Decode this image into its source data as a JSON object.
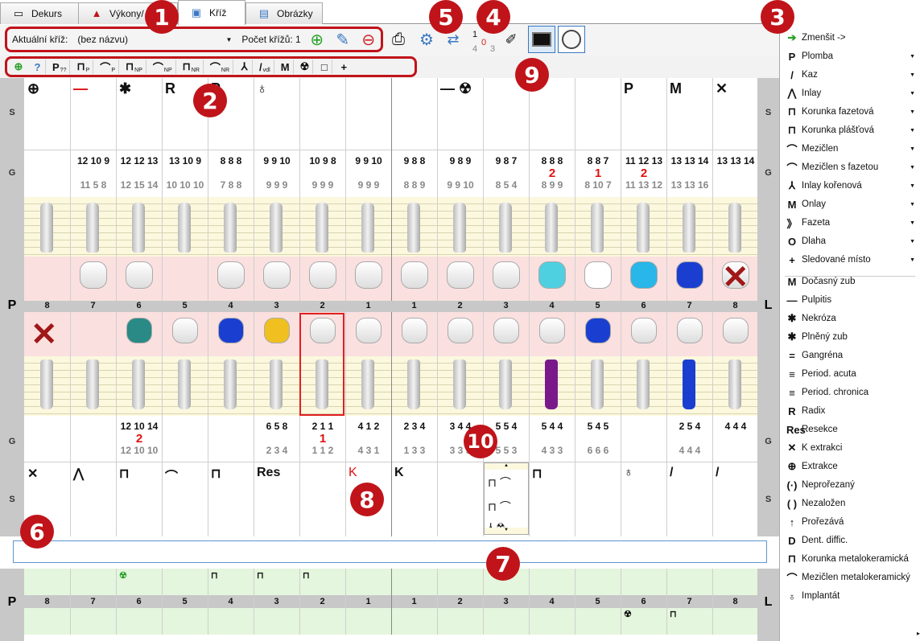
{
  "tabs": [
    {
      "label": "Dekurs",
      "icon": "document-icon"
    },
    {
      "label": "Výkony/",
      "icon": "procedures-icon"
    },
    {
      "label": "Kříž",
      "icon": "tooth-icon",
      "active": true
    },
    {
      "label": "Obrázky",
      "icon": "images-icon"
    }
  ],
  "toolbar": {
    "current_label": "Aktuální kříž:",
    "current_value": "(bez názvu)",
    "count_label": "Počet křížů: 1",
    "counter_top": "1",
    "counter_mid": "0",
    "counter_left": "4",
    "counter_right": "3"
  },
  "tools": [
    "P",
    "⊓",
    "⌒",
    "⊓",
    "⌒",
    "⊓",
    "⌒",
    "⅄",
    "/",
    "M",
    "☢",
    "□",
    "+"
  ],
  "tool_subs": [
    "??",
    "P",
    "P",
    "NP",
    "NP",
    "NR",
    "NR",
    "",
    "vdl",
    "",
    "",
    "",
    ""
  ],
  "side_labels": {
    "s": "S",
    "g": "G",
    "p": "P",
    "l": "L"
  },
  "upper_numbers": [
    "8",
    "7",
    "6",
    "5",
    "4",
    "3",
    "2",
    "1",
    "1",
    "2",
    "3",
    "4",
    "5",
    "6",
    "7",
    "8"
  ],
  "lower_numbers": [
    "8",
    "7",
    "6",
    "5",
    "4",
    "3",
    "2",
    "1",
    "1",
    "2",
    "3",
    "4",
    "5",
    "6",
    "7",
    "8"
  ],
  "upper_symbols": [
    "⊕",
    "—",
    "✱",
    "R",
    "P",
    "♁",
    "",
    "",
    "",
    "— ☢",
    "",
    "",
    "",
    "P",
    "M",
    "✕"
  ],
  "upper_g_top": [
    "",
    "12 10 9",
    "12 12 13",
    "13 10 9",
    "8 8 8",
    "9 9 10",
    "10 9 8",
    "9 9 10",
    "9 8 8",
    "9 8 9",
    "9 8 7",
    "8 8 8",
    "8 8 7",
    "11 12 13",
    "13 13 14",
    "13 13 14"
  ],
  "upper_g_bot": [
    "",
    "11 5 8",
    "12 15 14",
    "10 10 10",
    "7 8 8",
    "9 9 9",
    "9 9 9",
    "9 9 9",
    "8 8 9",
    "9 9 10",
    "8 5 4",
    "8 9 9",
    "8 10 7",
    "11 13 12",
    "13 13 16",
    ""
  ],
  "upper_g_red": [
    "",
    "",
    "",
    "",
    "",
    "",
    "",
    "",
    "",
    "",
    "",
    "2",
    "1",
    "2",
    "",
    ""
  ],
  "lower_g_top": [
    "",
    "",
    "12 10 14",
    "",
    "",
    "6 5 8",
    "2 1 1",
    "4 1 2",
    "2 3 4",
    "3 4 4",
    "5 5 4",
    "5 4 4",
    "5 4 5",
    "",
    "2 5 4",
    "4 4 4"
  ],
  "lower_g_bot": [
    "",
    "",
    "12 10 10",
    "",
    "",
    "2 3 4",
    "1 1 2",
    "4 3 1",
    "1 3 3",
    "3 3 5",
    "5 5 3",
    "4 3 3",
    "6 6 6",
    "",
    "4 4 4",
    ""
  ],
  "lower_g_red": [
    "",
    "",
    "2",
    "",
    "",
    "",
    "1",
    "",
    "",
    "",
    "",
    "",
    "",
    "",
    "",
    ""
  ],
  "lower_symbols": [
    "✕",
    "⋀",
    "⊓",
    "⌒",
    "⊓",
    "Res",
    "",
    "K",
    "K",
    "",
    "",
    "⊓",
    "",
    "♁",
    "/",
    "/"
  ],
  "legend": [
    {
      "l": "Zmenšit ->",
      "i": "➔"
    },
    {
      "l": "Plomba",
      "i": "P"
    },
    {
      "l": "Kaz",
      "i": "/"
    },
    {
      "l": "Inlay",
      "i": "⋀"
    },
    {
      "l": "Korunka fazetová",
      "i": "⊓"
    },
    {
      "l": "Korunka plášťová",
      "i": "⊓"
    },
    {
      "l": "Mezičlen",
      "i": "⌒"
    },
    {
      "l": "Mezičlen s fazetou",
      "i": "⌒"
    },
    {
      "l": "Inlay kořenová",
      "i": "⅄"
    },
    {
      "l": "Onlay",
      "i": "M"
    },
    {
      "l": "Fazeta",
      "i": "》"
    },
    {
      "l": "Dlaha",
      "i": "O"
    },
    {
      "l": "Sledované místo",
      "i": "+"
    },
    {
      "l": "Dočasný zub",
      "i": "M"
    },
    {
      "l": "Pulpitis",
      "i": "—"
    },
    {
      "l": "Nekróza",
      "i": "✱"
    },
    {
      "l": "Plněný zub",
      "i": "✱"
    },
    {
      "l": "Gangréna",
      "i": "="
    },
    {
      "l": "Period. acuta",
      "i": "≡"
    },
    {
      "l": "Period. chronica",
      "i": "≡"
    },
    {
      "l": "Radix",
      "i": "R"
    },
    {
      "l": "Resekce",
      "i": "Res"
    },
    {
      "l": "K extrakci",
      "i": "✕"
    },
    {
      "l": "Extrakce",
      "i": "⊕"
    },
    {
      "l": "Neprořezaný",
      "i": "(·)"
    },
    {
      "l": "Nezaložen",
      "i": "( )"
    },
    {
      "l": "Prořezává",
      "i": "↑"
    },
    {
      "l": "Dent. diffic.",
      "i": "D"
    },
    {
      "l": "Korunka metalokeramická",
      "i": "⊓"
    },
    {
      "l": "Mezičlen metalokeramický",
      "i": "⌒"
    },
    {
      "l": "Implantát",
      "i": "♁"
    }
  ],
  "legend_arrows": [
    false,
    true,
    true,
    true,
    true,
    true,
    true,
    true,
    true,
    true,
    true,
    true,
    true,
    false,
    false,
    false,
    false,
    false,
    false,
    false,
    false,
    false,
    false,
    false,
    false,
    false,
    false,
    false,
    false,
    false,
    false
  ],
  "callouts": [
    "1",
    "2",
    "3",
    "4",
    "5",
    "6",
    "7",
    "8",
    "9",
    "10"
  ],
  "mini_upper": [
    "",
    "",
    "☢",
    "",
    "⊓",
    "⊓",
    "⊓",
    "",
    "",
    "",
    "",
    "",
    "",
    "",
    "",
    ""
  ],
  "mini_lower": [
    "",
    "",
    "",
    "",
    "",
    "",
    "",
    "",
    "",
    "",
    "",
    "",
    "",
    "☢",
    "⊓",
    ""
  ],
  "colors": {
    "accent": "#c0141a",
    "caries": "#e01010",
    "filling_blue": "#1a3fd0",
    "crown_teal": "#2a8a85",
    "pink_band": "#fbe0e0",
    "root_band": "#fbf8de",
    "mini_band": "#e4f6dd"
  }
}
